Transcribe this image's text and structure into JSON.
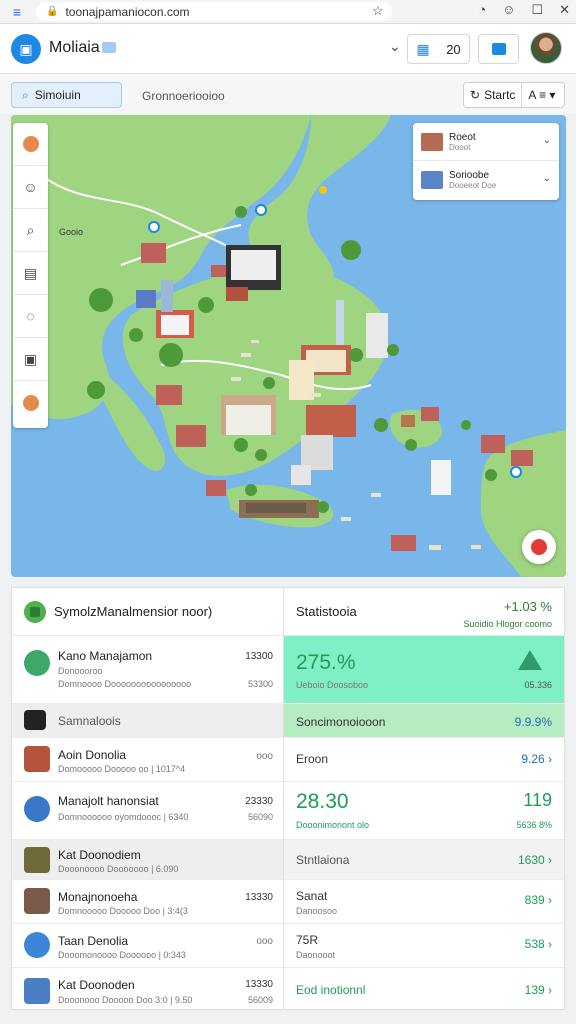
{
  "browser": {
    "url": "toonajpamaniocon.com",
    "menu_icon": "hamburger-icon",
    "star_icon": "star-icon"
  },
  "header": {
    "title": "Moliaia",
    "count_label": "20"
  },
  "toolbar": {
    "active_tool": "Simoiuin",
    "tab": "Gronnoeriooioo",
    "right_btn": "Startc",
    "right_dropdown": "A ≡ ▾"
  },
  "map": {
    "legend": [
      {
        "title": "Roeot",
        "sub": "Dooot"
      },
      {
        "title": "Sorioobe",
        "sub": "Dooeeot Doe"
      }
    ],
    "label": "Gooio",
    "colors": {
      "water": "#79b6ea",
      "land": "#9fd480",
      "road": "#ffffff"
    }
  },
  "left_panel": {
    "title": "SymolzManalmensior noor)",
    "rows": [
      {
        "title": "Kano Manajamon",
        "sub": "Donoooroo",
        "sub2": "Domnoooo Doooooooooooooooo",
        "num": "13300",
        "num2": "53300"
      },
      {
        "title": "Samnaloois",
        "grey": true
      },
      {
        "title": "Aoin Donolia",
        "sub": "Domooooo Dooooo oo | 1017^4",
        "num": "ooo"
      },
      {
        "title": "Manajolt hanonsiat",
        "sub": "Domnoooooo oyomdoooc | 6340",
        "num": "23330",
        "num2": "56090"
      },
      {
        "title": "Kat Doonodiem",
        "sub": "Dooonoooo Dooooooo | 6.090",
        "grey": true
      },
      {
        "title": "Monajnonoeha",
        "sub": "Domnooooo Dooooo Doo | 3:4(3",
        "num": "13330"
      },
      {
        "title": "Taan Denolia",
        "sub": "Dooomonoooo Doooooo | 0:343",
        "num": "ooo"
      },
      {
        "title": "Kat Doonoden",
        "sub": "Dooonooo Dooooo Doo 3:0 | 9.50",
        "num": "13330",
        "num2": "56009"
      }
    ]
  },
  "right_panel": {
    "title": "Statistooia",
    "value": "+1.03 %",
    "value_sub": "Suoidio Hlogor coomo",
    "rows": [
      {
        "big": "275.%",
        "sub": "Ueboio Doosoboo",
        "rv_sub": "05.336"
      },
      {
        "label": "Soncimonoiooon",
        "rv": "9.9.9%"
      },
      {
        "label": "Eroon",
        "rv": "9.26 ›"
      },
      {
        "big": "28.30",
        "sub": "Dooonimonont olo",
        "rv_big": "119",
        "rs": "5636 8%"
      },
      {
        "label": "Stntlaiona",
        "rv": "1630 ›"
      },
      {
        "label": "Sanat",
        "sub": "Danoosoo",
        "rv": "839 ›"
      },
      {
        "label": "75R",
        "sub": "Daonooot",
        "rv": "538 ›"
      },
      {
        "label": "Eod inotionnl",
        "rv": "139 ›"
      }
    ]
  }
}
